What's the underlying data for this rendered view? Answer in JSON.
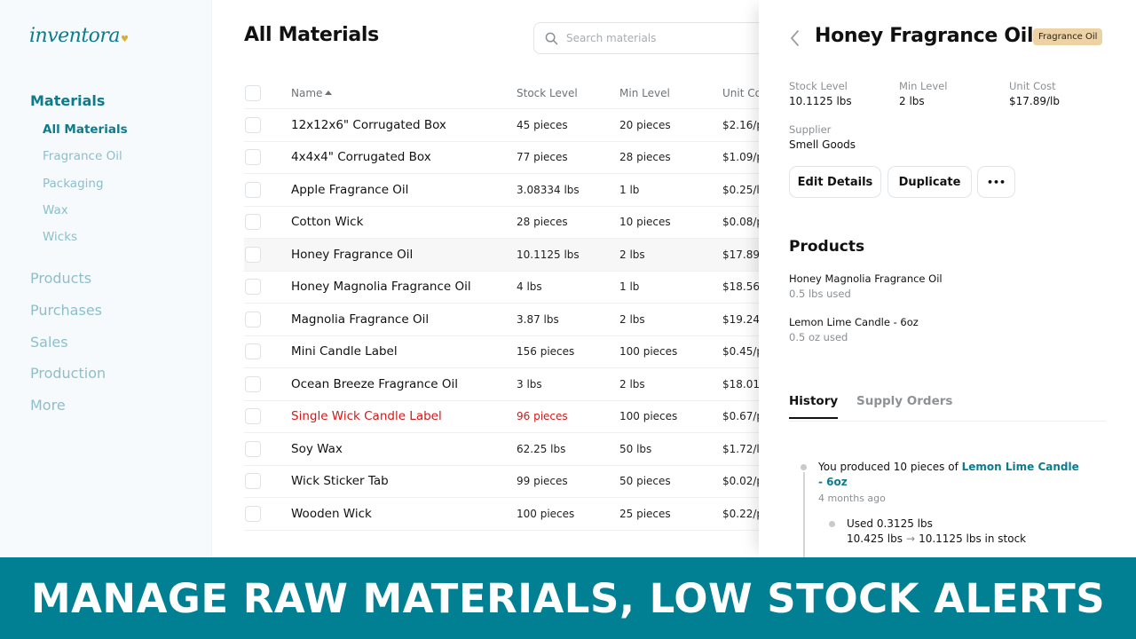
{
  "brand": {
    "logo_text": "inventora",
    "logo_mark": "♥",
    "accent_color": "#0e7b8c",
    "banner_color": "#017f93",
    "low_stock_color": "#d21919"
  },
  "sidebar": {
    "section": "Materials",
    "sub_items": [
      {
        "label": "All Materials",
        "active": true
      },
      {
        "label": "Fragrance Oil"
      },
      {
        "label": "Packaging"
      },
      {
        "label": "Wax"
      },
      {
        "label": "Wicks"
      }
    ],
    "main_items": [
      {
        "label": "Products"
      },
      {
        "label": "Purchases"
      },
      {
        "label": "Sales"
      },
      {
        "label": "Production"
      },
      {
        "label": "More"
      }
    ]
  },
  "main": {
    "title": "All Materials",
    "search": {
      "placeholder": "Search materials",
      "value": "",
      "icon": "search-icon"
    },
    "table": {
      "columns": [
        "Name",
        "Stock Level",
        "Min Level",
        "Unit Co"
      ],
      "sort": {
        "column": "Name",
        "direction": "asc"
      },
      "rows": [
        {
          "name": "12x12x6\" Corrugated Box",
          "stock": "45 pieces",
          "min": "20 pieces",
          "cost": "$2.16/p"
        },
        {
          "name": "4x4x4\" Corrugated Box",
          "stock": "77 pieces",
          "min": "28 pieces",
          "cost": "$1.09/p"
        },
        {
          "name": "Apple Fragrance Oil",
          "stock": "3.08334 lbs",
          "min": "1 lb",
          "cost": "$0.25/l"
        },
        {
          "name": "Cotton Wick",
          "stock": "28 pieces",
          "min": "10 pieces",
          "cost": "$0.08/p"
        },
        {
          "name": "Honey Fragrance Oil",
          "stock": "10.1125 lbs",
          "min": "2 lbs",
          "cost": "$17.89/",
          "selected": true
        },
        {
          "name": "Honey Magnolia Fragrance Oil",
          "stock": "4 lbs",
          "min": "1 lb",
          "cost": "$18.56/"
        },
        {
          "name": "Magnolia Fragrance Oil",
          "stock": "3.87 lbs",
          "min": "2 lbs",
          "cost": "$19.24/"
        },
        {
          "name": "Mini Candle Label",
          "stock": "156 pieces",
          "min": "100 pieces",
          "cost": "$0.45/p"
        },
        {
          "name": "Ocean Breeze Fragrance Oil",
          "stock": "3 lbs",
          "min": "2 lbs",
          "cost": "$18.01/l"
        },
        {
          "name": "Single Wick Candle Label",
          "stock": "96 pieces",
          "min": "100 pieces",
          "cost": "$0.67/p",
          "low_stock": true
        },
        {
          "name": "Soy Wax",
          "stock": "62.25 lbs",
          "min": "50 lbs",
          "cost": "$1.72/lb"
        },
        {
          "name": "Wick Sticker Tab",
          "stock": "99 pieces",
          "min": "50 pieces",
          "cost": "$0.02/p"
        },
        {
          "name": "Wooden Wick",
          "stock": "100 pieces",
          "min": "25 pieces",
          "cost": "$0.22/p"
        }
      ]
    }
  },
  "panel": {
    "title": "Honey Fragrance Oil",
    "category_badge": "Fragrance Oil",
    "stats": [
      {
        "label": "Stock Level",
        "value": "10.1125 lbs"
      },
      {
        "label": "Min Level",
        "value": "2 lbs"
      },
      {
        "label": "Unit Cost",
        "value": "$17.89/lb"
      },
      {
        "label": "Supplier",
        "value": "Smell Goods"
      }
    ],
    "buttons": {
      "edit": "Edit Details",
      "duplicate": "Duplicate",
      "more": "•••"
    },
    "products_title": "Products",
    "products": [
      {
        "name": "Honey Magnolia Fragrance Oil",
        "usage": "0.5 lbs used"
      },
      {
        "name": "Lemon Lime Candle - 6oz",
        "usage": "0.5 oz used"
      }
    ],
    "tabs": [
      {
        "label": "History",
        "active": true
      },
      {
        "label": "Supply Orders"
      }
    ],
    "history": [
      {
        "prefix": "You produced 10 pieces of ",
        "link": "Lemon Lime Candle - 6oz",
        "time": "4 months ago",
        "detail": {
          "title": "Used 0.3125 lbs",
          "from": "10.425 lbs",
          "to": "10.1125 lbs in stock"
        }
      }
    ]
  },
  "banner": {
    "text": "MANAGE RAW MATERIALS, LOW STOCK ALERTS"
  }
}
